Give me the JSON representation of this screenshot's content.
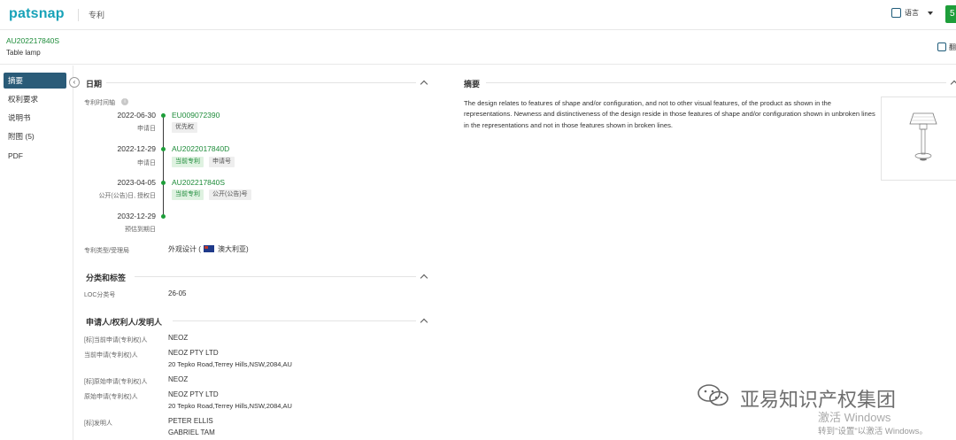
{
  "topbar": {
    "logo": "patsnap",
    "section": "专利",
    "language": "语言",
    "green_button": "5"
  },
  "patent": {
    "number": "AU202217840S",
    "title": "Table lamp",
    "translate_label": "翻"
  },
  "nav": {
    "items": [
      "摘要",
      "权利要求",
      "说明书",
      "附图 (5)",
      "PDF"
    ],
    "active": 0
  },
  "dates_section": {
    "title": "日期",
    "timeline_label": "专利时间轴",
    "events": [
      {
        "date": "2022-06-30",
        "type": "申请日",
        "number": "EU009072390",
        "tags": [
          {
            "text": "优先权",
            "style": "gray"
          }
        ]
      },
      {
        "date": "2022-12-29",
        "type": "申请日",
        "number": "AU2022017840D",
        "tags": [
          {
            "text": "当前专利",
            "style": "green"
          },
          {
            "text": "申请号",
            "style": "gray"
          }
        ]
      },
      {
        "date": "2023-04-05",
        "type": "公开(公告)日, 授权日",
        "number": "AU202217840S",
        "tags": [
          {
            "text": "当前专利",
            "style": "green"
          },
          {
            "text": "公开(公告)号",
            "style": "gray"
          }
        ]
      },
      {
        "date": "2032-12-29",
        "type": "预估到期日",
        "number": "",
        "tags": []
      }
    ],
    "patent_type_label": "专利类型/受理局",
    "patent_type_value": "外观设计 (",
    "patent_office": "澳大利亚)"
  },
  "classification": {
    "title": "分类和标签",
    "loc_label": "LOC分类号",
    "loc_value": "26-05"
  },
  "parties": {
    "title": "申请人/权利人/发明人",
    "rows": [
      {
        "label": "[标]当前申请(专利权)人",
        "lines": [
          "NEOZ"
        ]
      },
      {
        "label": "当前申请(专利权)人",
        "lines": [
          "NEOZ PTY LTD",
          "20 Tepko Road,Terrey Hills,NSW,2084,AU"
        ]
      },
      {
        "label": "[标]原始申请(专利权)人",
        "lines": [
          "NEOZ"
        ]
      },
      {
        "label": "原始申请(专利权)人",
        "lines": [
          "NEOZ PTY LTD",
          "20 Tepko Road,Terrey Hills,NSW,2084,AU"
        ]
      },
      {
        "label": "[标]发明人",
        "lines": [
          "PETER ELLIS",
          "GABRIEL TAM"
        ]
      }
    ]
  },
  "abstract": {
    "title": "摘要",
    "text": "The design relates to features of shape and/or configuration, and not to other visual features, of the product as shown in the representations. Newness and distinctiveness of the design reside in those features of shape and/or configuration shown in unbroken lines in the representations and not in those features shown in broken lines."
  },
  "overlay": {
    "watermark": "亚易知识产权集团",
    "activate_title": "激活 Windows",
    "activate_hint": "转到\"设置\"以激活 Windows。"
  },
  "colors": {
    "brand": "#17a2b8",
    "accent_green": "#1e8c3a",
    "nav_active": "#2a5b78"
  }
}
